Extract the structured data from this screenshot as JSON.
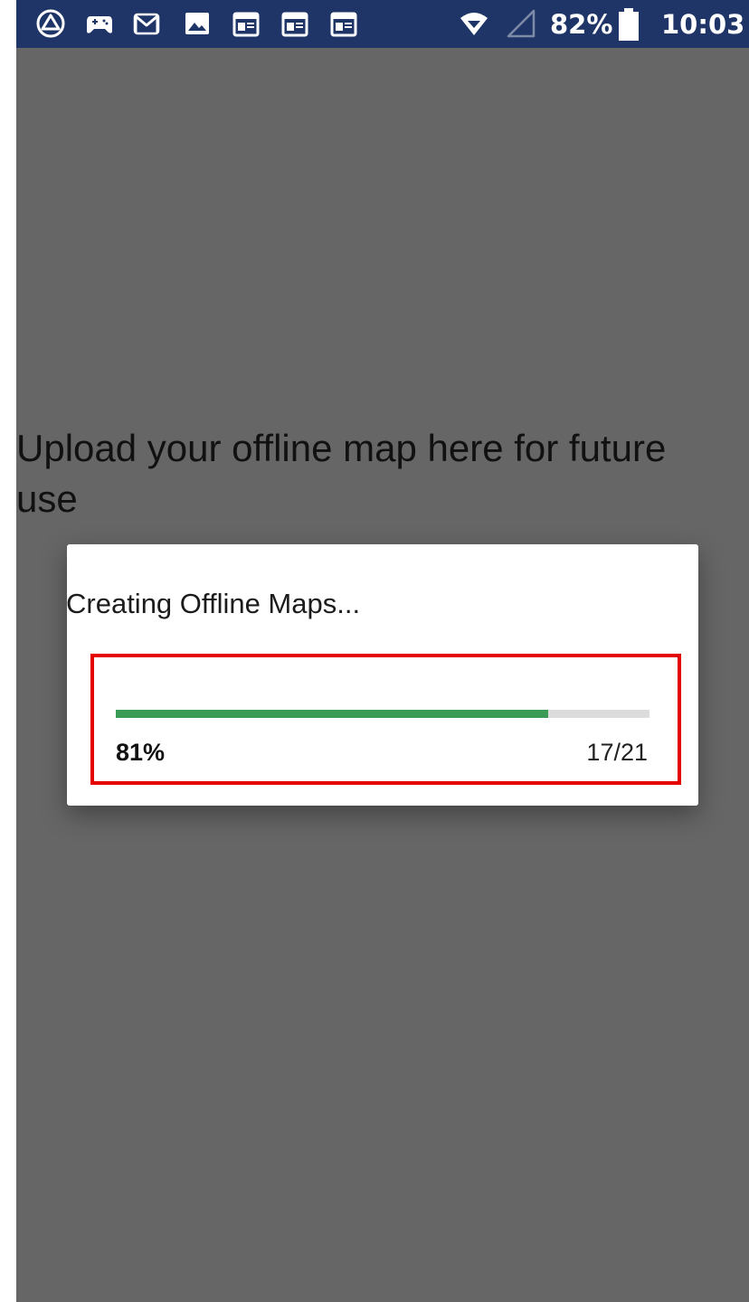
{
  "status_bar": {
    "left_icons": [
      "drive-icon",
      "gamepad-icon",
      "gmail-icon",
      "gallery-icon",
      "calendar-icon",
      "calendar-icon",
      "calendar-icon"
    ],
    "right_icons": [
      "wifi-icon",
      "signal-icon",
      "battery-icon"
    ],
    "battery_percent": "82%",
    "time": "10:03",
    "background_color": "#1f3568"
  },
  "page": {
    "heading": "Upload your offline map here for future use",
    "background_color": "#666666"
  },
  "dialog": {
    "title": "Creating Offline Maps...",
    "progress": {
      "percent_label": "81%",
      "count_label": "17/21",
      "value": 0.81,
      "fill_color": "#3a9b57",
      "track_color": "#dcdcdc"
    },
    "highlight_color": "#e50000"
  }
}
